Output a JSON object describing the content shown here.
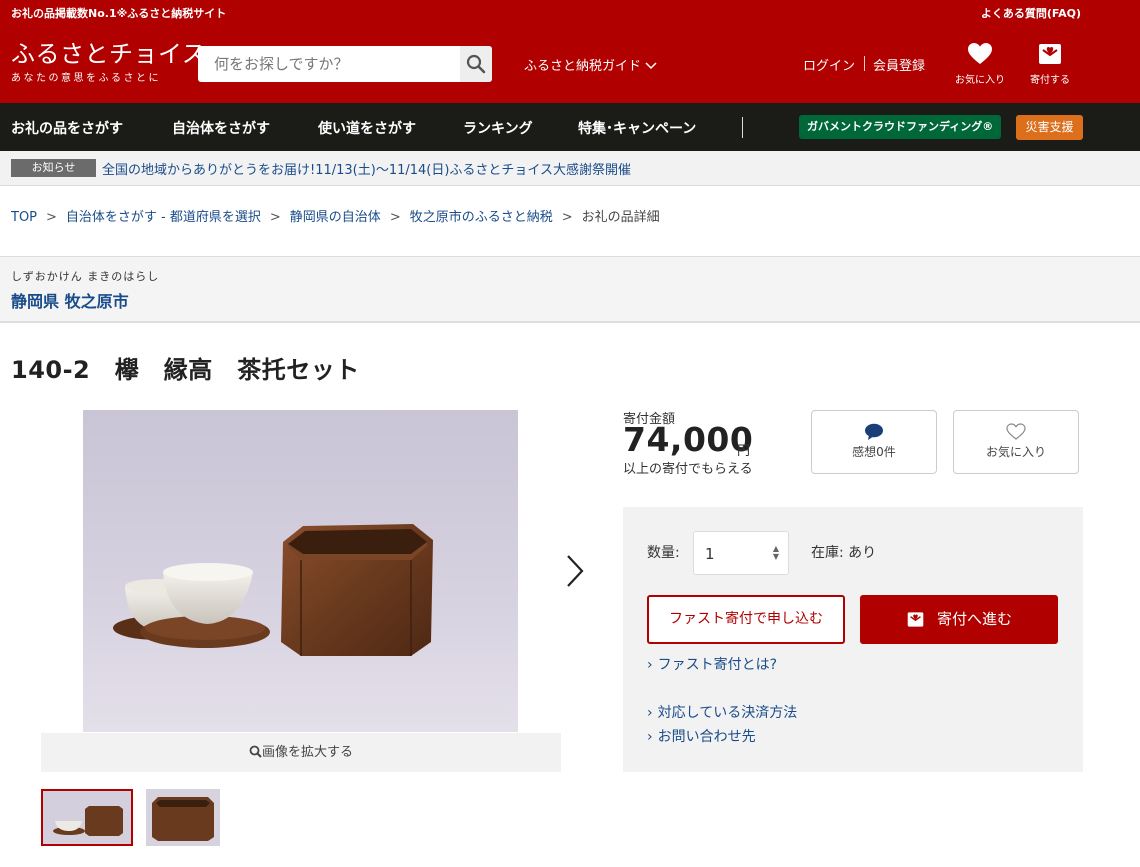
{
  "topbar": {
    "tagline": "お礼の品掲載数No.1※ふるさと納税サイト",
    "faq": "よくある質問(FAQ)"
  },
  "header": {
    "logo_main": "ふるさとチョイス",
    "logo_sub": "あなたの意思をふるさとに",
    "search_placeholder": "何をお探しですか？",
    "guide": "ふるさと納税ガイド",
    "login": "ログイン",
    "register": "会員登録",
    "favorites": "お気に入り",
    "donate": "寄付する",
    "brand_color": "#b10000"
  },
  "nav": {
    "items": [
      "お礼の品をさがす",
      "自治体をさがす",
      "使い道をさがす",
      "ランキング",
      "特集･キャンペーン"
    ],
    "gcf": "ガバメントクラウドファンディング®",
    "disaster": "災害支援"
  },
  "notice": {
    "badge": "お知らせ",
    "message": "全国の地域からありがとうをお届け!11/13(土)〜11/14(日)ふるさとチョイス大感謝祭開催"
  },
  "breadcrumb": [
    "TOP",
    "自治体をさがす - 都道府県を選択",
    "静岡県の自治体",
    "牧之原市のふるさと納税",
    "お礼の品詳細"
  ],
  "municipality": {
    "kana": "しずおかけん まきのはらし",
    "name": "静岡県 牧之原市"
  },
  "product": {
    "title": "140-2　欅　縁高　茶托セット",
    "zoom_label": "画像を拡大する",
    "price_label": "寄付金額",
    "price": "74,000",
    "price_unit": "円",
    "price_note": "以上の寄付でもらえる",
    "reviews": "感想0件",
    "favorite": "お気に入り"
  },
  "order": {
    "qty_label": "数量:",
    "qty_value": "1",
    "stock": "在庫: あり",
    "fast_button": "ファスト寄付で申し込む",
    "donate_button": "寄付へ進む",
    "links": [
      "ファスト寄付とは?",
      "対応している決済方法",
      "お問い合わせ先"
    ]
  }
}
